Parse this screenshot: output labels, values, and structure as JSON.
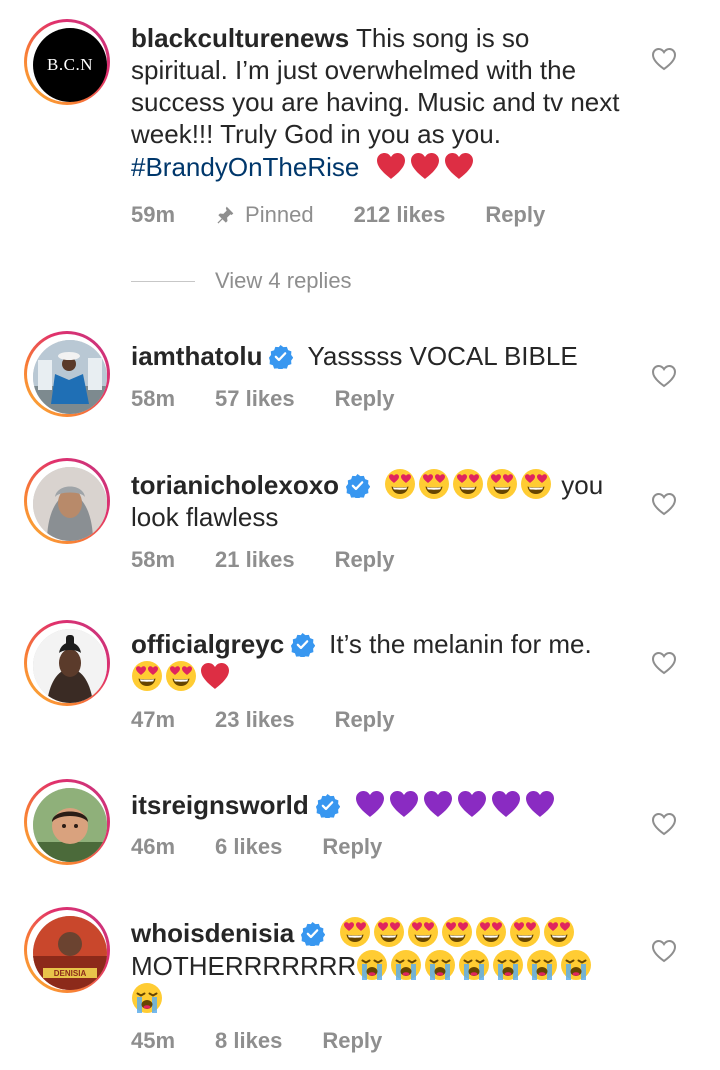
{
  "comments": [
    {
      "username": "blackculturenews",
      "avatar_text": "B.C.N",
      "text": "This song is so spiritual. I’m just overwhelmed with the success you are having. Music and tv next week!!! Truly God in you as you.",
      "hashtag": "#BrandyOnTheRise",
      "time": "59m",
      "pinned": "Pinned",
      "likes": "212 likes",
      "reply": "Reply"
    },
    {
      "username": "iamthatolu",
      "text": "Yasssss VOCAL BIBLE",
      "time": "58m",
      "likes": "57 likes",
      "reply": "Reply"
    },
    {
      "username": "torianicholexoxo",
      "text_after_emoji": "you",
      "text_line2": "look flawless",
      "time": "58m",
      "likes": "21 likes",
      "reply": "Reply"
    },
    {
      "username": "officialgreyc",
      "text": "It’s the melanin for me.",
      "time": "47m",
      "likes": "23 likes",
      "reply": "Reply"
    },
    {
      "username": "itsreignsworld",
      "time": "46m",
      "likes": "6 likes",
      "reply": "Reply"
    },
    {
      "username": "whoisdenisia",
      "text_line2": "MOTHERRRRRRR",
      "time": "45m",
      "likes": "8 likes",
      "reply": "Reply"
    }
  ],
  "view_replies": "View 4 replies",
  "colors": {
    "text": "#262626",
    "meta": "#8e8e8e",
    "hashtag": "#00376b",
    "verified": "#3897f0"
  },
  "icons": [
    "heart-outline-icon",
    "pin-icon",
    "verified-badge-icon",
    "red-heart-emoji",
    "heart-eyes-emoji",
    "purple-heart-emoji",
    "crying-emoji"
  ]
}
